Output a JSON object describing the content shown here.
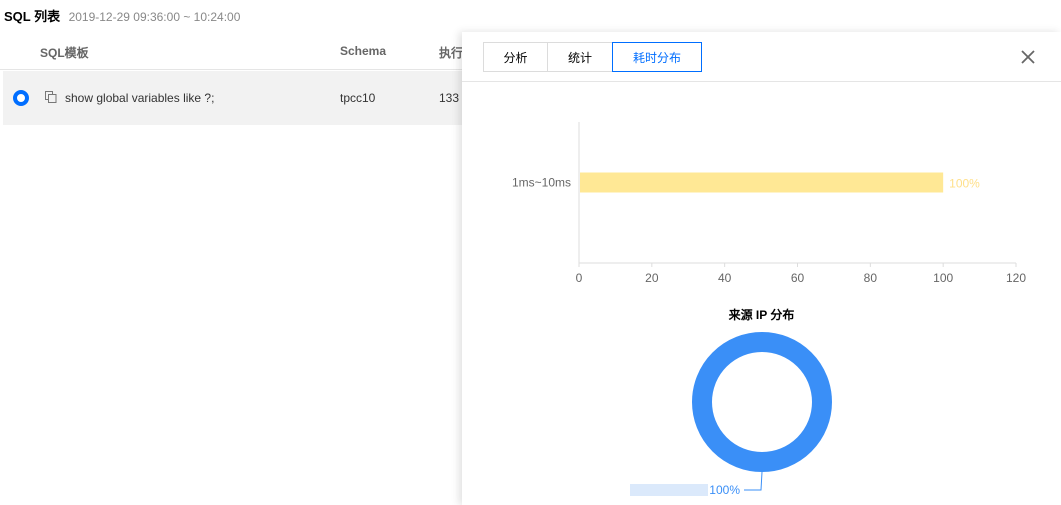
{
  "header": {
    "title": "SQL 列表",
    "time_range": "2019-12-29 09:36:00 ~ 10:24:00"
  },
  "table": {
    "columns": [
      "SQL模板",
      "Schema",
      "执行"
    ],
    "rows": [
      {
        "sql": "show global variables like ?;",
        "schema": "tpcc10",
        "exec": "133"
      }
    ]
  },
  "drawer": {
    "tabs": [
      {
        "label": "分析",
        "active": false
      },
      {
        "label": "统计",
        "active": false
      },
      {
        "label": "耗时分布",
        "active": true
      }
    ],
    "close_icon": "close-icon"
  },
  "colors": {
    "accent": "#006eff",
    "bar": "#ffe895",
    "bar_label": "#ffe08a",
    "donut": "#3a8ff7"
  },
  "chart_data": [
    {
      "type": "bar",
      "orientation": "horizontal",
      "categories": [
        "1ms~10ms"
      ],
      "values": [
        100
      ],
      "value_labels": [
        "100%"
      ],
      "xlim": [
        0,
        120
      ],
      "xticks": [
        0,
        20,
        40,
        60,
        80,
        100,
        120
      ],
      "grid": false
    },
    {
      "type": "pie",
      "title": "来源 IP 分布",
      "donut": true,
      "values": [
        100
      ],
      "value_labels": [
        "100%"
      ]
    }
  ]
}
